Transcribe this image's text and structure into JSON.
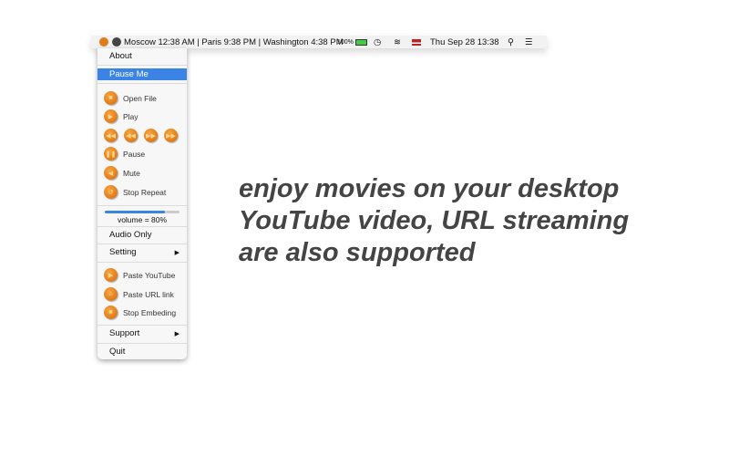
{
  "menubar": {
    "clocks": "Moscow 12:38 AM | Paris 9:38 PM | Washington 4:38 PM",
    "battery": "100%",
    "datetime": "Thu Sep 28  13:38"
  },
  "menu": {
    "about": "About",
    "pause_me": "Pause Me",
    "open_file": "Open File",
    "play": "Play",
    "pause": "Pause",
    "mute": "Mute",
    "stop_repeat": "Stop Repeat",
    "volume_label": "volume = 80%",
    "volume": 0.8,
    "audio_only": "Audio Only",
    "setting": "Setting",
    "paste_youtube": "Paste YouTube",
    "paste_url": "Paste URL link",
    "stop_embeding": "Stop Embeding",
    "support": "Support",
    "quit": "Quit"
  },
  "tagline": [
    "enjoy movies on your desktop",
    "YouTube video, URL streaming",
    "are also supported"
  ],
  "colors": {
    "accent": "#3b84e6",
    "icon": "#e07a1a"
  }
}
